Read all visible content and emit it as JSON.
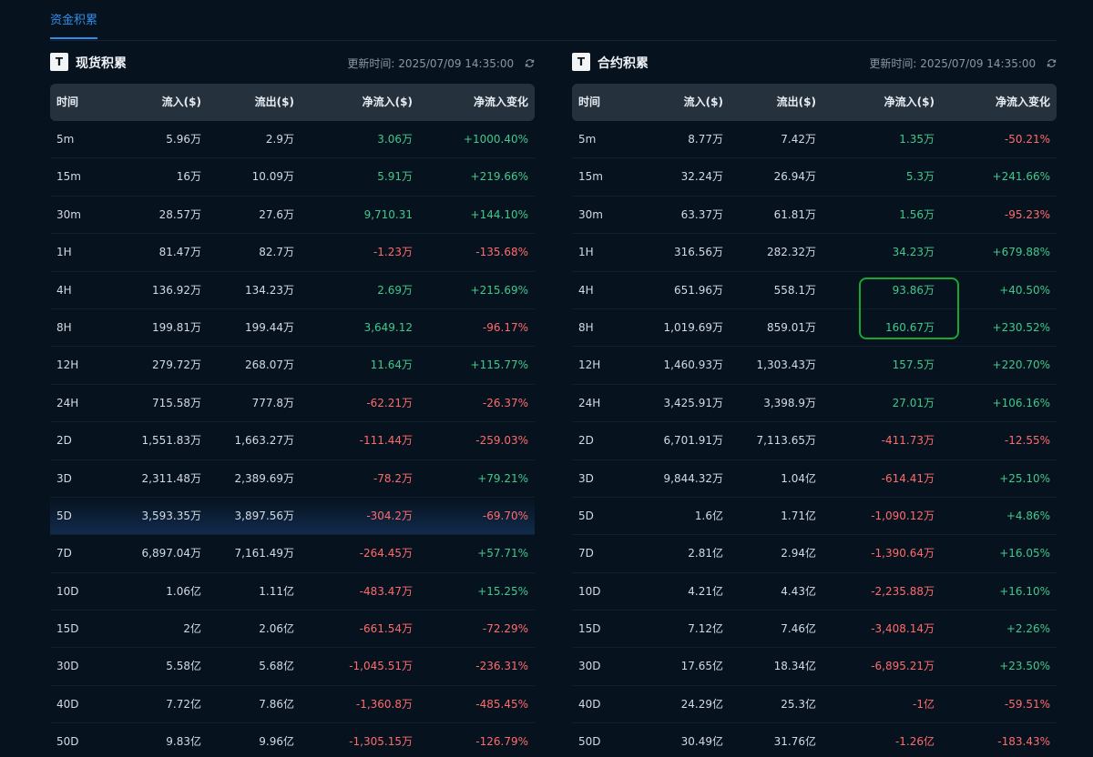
{
  "tab": {
    "label": "资金积累"
  },
  "spot": {
    "title": "现货积累",
    "icon": "T",
    "update_label": "更新时间:",
    "update_time": "2025/07/09 14:35:00",
    "columns": [
      "时间",
      "流入($)",
      "流出($)",
      "净流入($)",
      "净流入变化"
    ],
    "rows": [
      [
        "5m",
        "5.96万",
        "2.9万",
        "3.06万",
        "+1000.40%"
      ],
      [
        "15m",
        "16万",
        "10.09万",
        "5.91万",
        "+219.66%"
      ],
      [
        "30m",
        "28.57万",
        "27.6万",
        "9,710.31",
        "+144.10%"
      ],
      [
        "1H",
        "81.47万",
        "82.7万",
        "-1.23万",
        "-135.68%"
      ],
      [
        "4H",
        "136.92万",
        "134.23万",
        "2.69万",
        "+215.69%"
      ],
      [
        "8H",
        "199.81万",
        "199.44万",
        "3,649.12",
        "-96.17%"
      ],
      [
        "12H",
        "279.72万",
        "268.07万",
        "11.64万",
        "+115.77%"
      ],
      [
        "24H",
        "715.58万",
        "777.8万",
        "-62.21万",
        "-26.37%"
      ],
      [
        "2D",
        "1,551.83万",
        "1,663.27万",
        "-111.44万",
        "-259.03%"
      ],
      [
        "3D",
        "2,311.48万",
        "2,389.69万",
        "-78.2万",
        "+79.21%"
      ],
      [
        "5D",
        "3,593.35万",
        "3,897.56万",
        "-304.2万",
        "-69.70%"
      ],
      [
        "7D",
        "6,897.04万",
        "7,161.49万",
        "-264.45万",
        "+57.71%"
      ],
      [
        "10D",
        "1.06亿",
        "1.11亿",
        "-483.47万",
        "+15.25%"
      ],
      [
        "15D",
        "2亿",
        "2.06亿",
        "-661.54万",
        "-72.29%"
      ],
      [
        "30D",
        "5.58亿",
        "5.68亿",
        "-1,045.51万",
        "-236.31%"
      ],
      [
        "40D",
        "7.72亿",
        "7.86亿",
        "-1,360.8万",
        "-485.45%"
      ],
      [
        "50D",
        "9.83亿",
        "9.96亿",
        "-1,305.15万",
        "-126.79%"
      ]
    ]
  },
  "futures": {
    "title": "合约积累",
    "icon": "T",
    "update_label": "更新时间:",
    "update_time": "2025/07/09 14:35:00",
    "columns": [
      "时间",
      "流入($)",
      "流出($)",
      "净流入($)",
      "净流入变化"
    ],
    "rows": [
      [
        "5m",
        "8.77万",
        "7.42万",
        "1.35万",
        "-50.21%"
      ],
      [
        "15m",
        "32.24万",
        "26.94万",
        "5.3万",
        "+241.66%"
      ],
      [
        "30m",
        "63.37万",
        "61.81万",
        "1.56万",
        "-95.23%"
      ],
      [
        "1H",
        "316.56万",
        "282.32万",
        "34.23万",
        "+679.88%"
      ],
      [
        "4H",
        "651.96万",
        "558.1万",
        "93.86万",
        "+40.50%"
      ],
      [
        "8H",
        "1,019.69万",
        "859.01万",
        "160.67万",
        "+230.52%"
      ],
      [
        "12H",
        "1,460.93万",
        "1,303.43万",
        "157.5万",
        "+220.70%"
      ],
      [
        "24H",
        "3,425.91万",
        "3,398.9万",
        "27.01万",
        "+106.16%"
      ],
      [
        "2D",
        "6,701.91万",
        "7,113.65万",
        "-411.73万",
        "-12.55%"
      ],
      [
        "3D",
        "9,844.32万",
        "1.04亿",
        "-614.41万",
        "+25.10%"
      ],
      [
        "5D",
        "1.6亿",
        "1.71亿",
        "-1,090.12万",
        "+4.86%"
      ],
      [
        "7D",
        "2.81亿",
        "2.94亿",
        "-1,390.64万",
        "+16.05%"
      ],
      [
        "10D",
        "4.21亿",
        "4.43亿",
        "-2,235.88万",
        "+16.10%"
      ],
      [
        "15D",
        "7.12亿",
        "7.46亿",
        "-3,408.14万",
        "+2.26%"
      ],
      [
        "30D",
        "17.65亿",
        "18.34亿",
        "-6,895.21万",
        "+23.50%"
      ],
      [
        "40D",
        "24.29亿",
        "25.3亿",
        "-1亿",
        "-59.51%"
      ],
      [
        "50D",
        "30.49亿",
        "31.76亿",
        "-1.26亿",
        "-183.43%"
      ]
    ]
  },
  "colors": {
    "positive": "#3fc98a",
    "negative": "#ff6b6b",
    "accent": "#2f8ee8",
    "highlight_box": "#16a832"
  },
  "highlighted_row": "5D"
}
